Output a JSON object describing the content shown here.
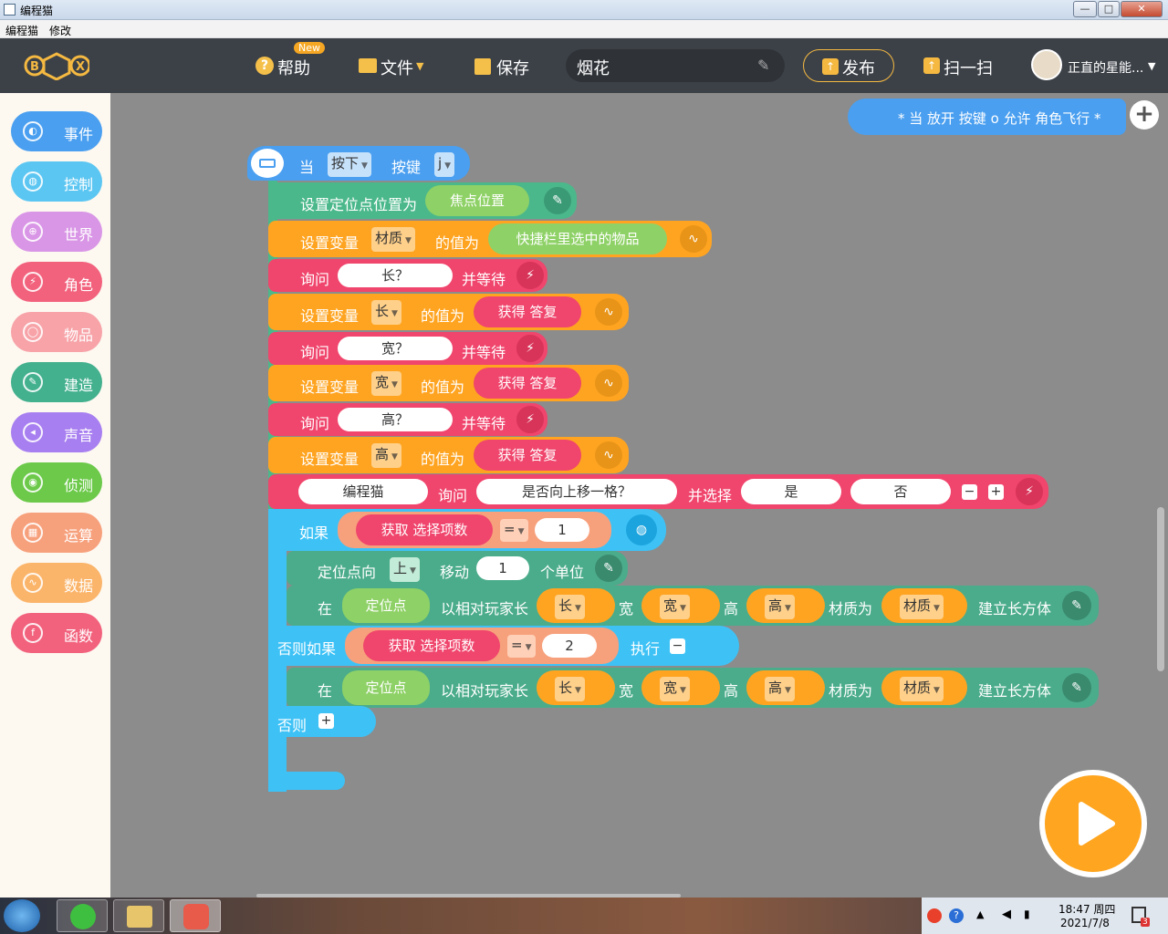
{
  "window": {
    "title": "编程猫",
    "min": "—",
    "max": "□",
    "close": "✕"
  },
  "menu": [
    "编程猫",
    "修改"
  ],
  "nav": {
    "logo": "BOX",
    "help": "帮助",
    "help_badge": "New",
    "file": "文件",
    "save": "保存",
    "project_name": "烟花",
    "publish": "发布",
    "scan": "扫一扫",
    "username": "正直的星能..."
  },
  "categories": [
    {
      "label": "事件",
      "color": "#4a9ff0",
      "icon": "toggle-icon"
    },
    {
      "label": "控制",
      "color": "#5cc6f2",
      "icon": "gamepad-icon"
    },
    {
      "label": "世界",
      "color": "#d996e6",
      "icon": "globe-icon"
    },
    {
      "label": "角色",
      "color": "#f2627d",
      "icon": "run-icon"
    },
    {
      "label": "物品",
      "color": "#f7a3a8",
      "icon": "potion-icon"
    },
    {
      "label": "建造",
      "color": "#43b08e",
      "icon": "wrench-icon"
    },
    {
      "label": "声音",
      "color": "#a87ff0",
      "icon": "speaker-icon"
    },
    {
      "label": "侦测",
      "color": "#6cc94a",
      "icon": "radar-icon"
    },
    {
      "label": "运算",
      "color": "#f7a07c",
      "icon": "calculator-icon"
    },
    {
      "label": "数据",
      "color": "#fbb56b",
      "icon": "wave-icon"
    },
    {
      "label": "函数",
      "color": "#f2627d",
      "icon": "fx-icon"
    }
  ],
  "comment": "* 当 放开 按键 o 允许 角色飞行 *",
  "script": {
    "hat": {
      "when": "当",
      "action": "按下",
      "key_label": "按键",
      "key": "j"
    },
    "b1": {
      "text": "设置定位点位置为",
      "value": "焦点位置"
    },
    "b2": {
      "text": "设置变量",
      "var": "材质",
      "mid": "的值为",
      "value": "快捷栏里选中的物品"
    },
    "ask1": {
      "text": "询问",
      "q": "长？",
      "tail": "并等待"
    },
    "set_len": {
      "text": "设置变量",
      "var": "长",
      "mid": "的值为",
      "value": "获得 答复"
    },
    "ask2": {
      "text": "询问",
      "q": "宽？",
      "tail": "并等待"
    },
    "set_wid": {
      "text": "设置变量",
      "var": "宽",
      "mid": "的值为",
      "value": "获得 答复"
    },
    "ask3": {
      "text": "询问",
      "q": "高？",
      "tail": "并等待"
    },
    "set_hei": {
      "text": "设置变量",
      "var": "高",
      "mid": "的值为",
      "value": "获得 答复"
    },
    "choice": {
      "who": "编程猫",
      "ask": "询问",
      "q": "是否向上移一格？",
      "tail": "并选择",
      "opt1": "是",
      "opt2": "否"
    },
    "if1": {
      "text": "如果",
      "cond": "获取 选择项数",
      "op": "=",
      "val": "1"
    },
    "move": {
      "text": "定位点向",
      "dir": "上",
      "mid": "移动",
      "n": "1",
      "unit": "个单位"
    },
    "build1": {
      "at": "在",
      "pt": "定位点",
      "rel": "以相对玩家长",
      "l": "长",
      "wl": "宽",
      "w": "宽",
      "hl": "高",
      "h": "高",
      "ml": "材质为",
      "m": "材质",
      "end": "建立长方体"
    },
    "elif": {
      "text": "否则如果",
      "cond": "获取 选择项数",
      "op": "=",
      "val": "2",
      "exec": "执行"
    },
    "build2": {
      "at": "在",
      "pt": "定位点",
      "rel": "以相对玩家长",
      "l": "长",
      "wl": "宽",
      "w": "宽",
      "hl": "高",
      "h": "高",
      "ml": "材质为",
      "m": "材质",
      "end": "建立长方体"
    },
    "else": {
      "text": "否则"
    }
  },
  "taskbar": {
    "time": "18:47 周四",
    "date": "2021/7/8",
    "notif": "3"
  }
}
